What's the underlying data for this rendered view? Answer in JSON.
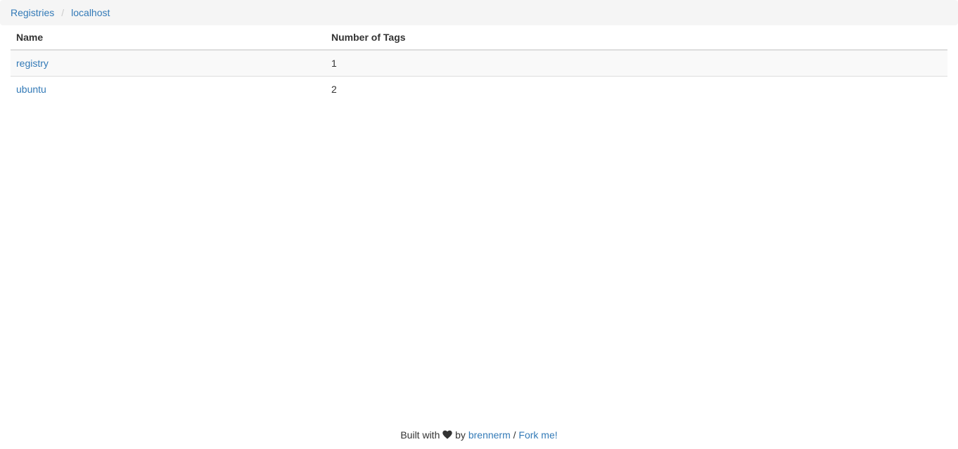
{
  "breadcrumb": {
    "items": [
      {
        "label": "Registries"
      },
      {
        "label": "localhost"
      }
    ],
    "separator": "/"
  },
  "table": {
    "headers": [
      "Name",
      "Number of Tags"
    ],
    "rows": [
      {
        "name": "registry",
        "tags": "1"
      },
      {
        "name": "ubuntu",
        "tags": "2"
      }
    ]
  },
  "footer": {
    "prefix": "Built with",
    "icon": "heart-icon",
    "by": "by",
    "author_link": "brennerm",
    "divider": "/",
    "fork_link": "Fork me!"
  },
  "colors": {
    "link": "#337ab7",
    "text": "#333333",
    "breadcrumb_bg": "#f5f5f5",
    "stripe": "#f9f9f9",
    "border": "#dddddd"
  }
}
